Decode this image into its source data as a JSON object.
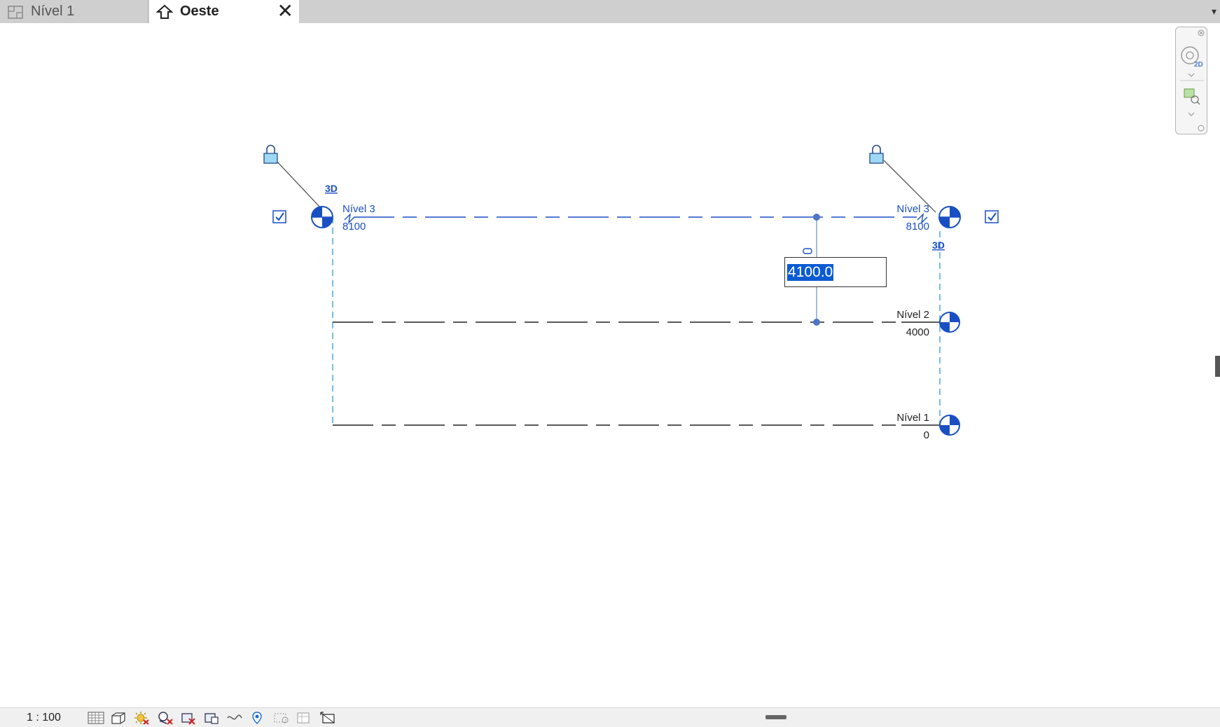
{
  "tabs": [
    {
      "label": "Nível 1",
      "icon": "floor-plan-icon",
      "active": false
    },
    {
      "label": "Oeste",
      "icon": "elevation-home-icon",
      "active": true,
      "close": "close-icon"
    }
  ],
  "levels": [
    {
      "name": "Nível 3",
      "elevation": "8100",
      "selected": true
    },
    {
      "name": "Nível 2",
      "elevation": "4000",
      "selected": false
    },
    {
      "name": "Nível 1",
      "elevation": "0",
      "selected": false
    }
  ],
  "markers": {
    "3d_left": "3D",
    "3d_right": "3D"
  },
  "dimension": {
    "value": "4100.0"
  },
  "status": {
    "scale": "1 : 100"
  },
  "status_icons": [
    "detail-level-icon",
    "visual-style-icon",
    "sun-path-icon",
    "shadows-icon",
    "crop-view-icon",
    "show-crop-region-icon",
    "unlock-3d-view-icon",
    "temporary-hide-icon",
    "reveal-hidden-icon",
    "temporary-view-properties-icon",
    "analytical-model-icon"
  ],
  "colors": {
    "selected": "#1a4fc4",
    "extent": "#49a8e0",
    "line": "#222222"
  }
}
